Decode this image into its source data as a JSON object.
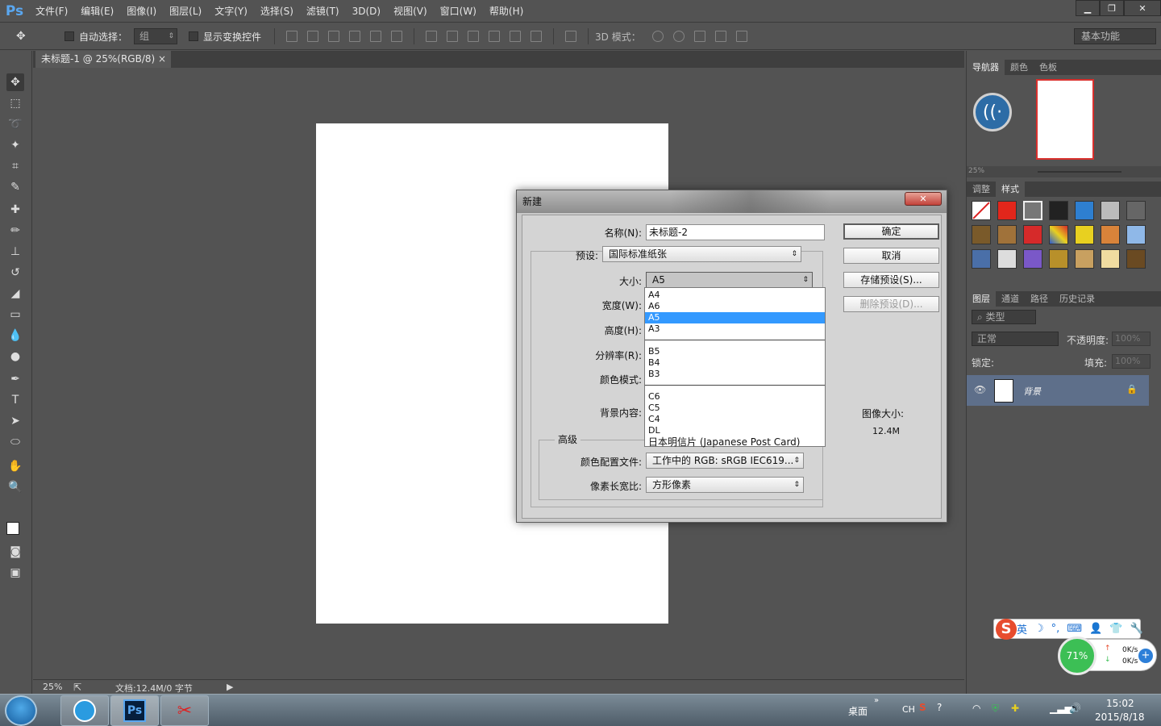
{
  "app": {
    "logo": "Ps"
  },
  "menu": [
    "文件(F)",
    "编辑(E)",
    "图像(I)",
    "图层(L)",
    "文字(Y)",
    "选择(S)",
    "滤镜(T)",
    "3D(D)",
    "视图(V)",
    "窗口(W)",
    "帮助(H)"
  ],
  "window_controls": {
    "minimize": "▁",
    "restore": "❐",
    "close": "✕"
  },
  "options": {
    "auto_select_label": "自动选择：",
    "auto_select_value": "组",
    "show_transform_label": "显示变换控件",
    "mode3d_label": "3D 模式：",
    "workspace": "基本功能"
  },
  "document": {
    "tab_title": "未标题-1 @ 25%(RGB/8)",
    "tab_close": "×",
    "zoom": "25%",
    "doc_info": "文档:12.4M/0 字节"
  },
  "panels": {
    "nav_tabs": [
      "导航器",
      "颜色",
      "色板"
    ],
    "nav_zoom": "25%",
    "adj_tabs": [
      "调整",
      "样式"
    ],
    "layer_tabs": [
      "图层",
      "通道",
      "路径",
      "历史记录"
    ],
    "layer_kind": "类型",
    "blend_mode": "正常",
    "opacity_label": "不透明度:",
    "opacity_value": "100%",
    "lock_label": "锁定:",
    "fill_label": "填充:",
    "fill_value": "100%",
    "layer_name": "背景",
    "style_colors": [
      "#ffffff",
      "#e2261b",
      "#777777",
      "#222222",
      "#2e7fd0",
      "#bbbbbb",
      "#666666",
      "#7a5a2a",
      "#a0723a",
      "#d62a2a",
      "#2b5bd0",
      "#e8d020",
      "#d8833a",
      "#8fb8e8",
      "#4a6fa8",
      "#dddddd",
      "#7a58c8",
      "#b8902a",
      "#c8a060",
      "#f0dca0",
      "#6a4a22"
    ]
  },
  "dialog": {
    "title": "新建",
    "close": "✕",
    "name_label": "名称(N):",
    "name_value": "未标题-2",
    "preset_label": "预设:",
    "preset_value": "国际标准纸张",
    "size_label": "大小:",
    "size_value": "A5",
    "width_label": "宽度(W):",
    "height_label": "高度(H):",
    "resolution_label": "分辨率(R):",
    "color_mode_label": "颜色模式:",
    "bg_label": "背景内容:",
    "advanced_label": "高级",
    "profile_label": "颜色配置文件:",
    "profile_value": "工作中的 RGB: sRGB IEC619...",
    "aspect_label": "像素长宽比:",
    "aspect_value": "方形像素",
    "ok": "确定",
    "cancel": "取消",
    "save_preset": "存储预设(S)...",
    "delete_preset": "删除预设(D)...",
    "image_size_label": "图像大小:",
    "image_size_value": "12.4M",
    "size_options_g1": [
      "A4",
      "A6",
      "A5",
      "A3"
    ],
    "size_options_g2": [
      "B5",
      "B4",
      "B3"
    ],
    "size_options_g3": [
      "C6",
      "C5",
      "C4",
      "DL",
      "日本明信片 (Japanese Post Card)"
    ]
  },
  "ime": {
    "logo": "S",
    "lang": "英",
    "moon": "☽",
    "punct": "°,",
    "kbd": "⌨",
    "user": "👤",
    "shirt": "👕",
    "wrench": "🔧"
  },
  "network": {
    "percent": "71%",
    "up": "0K/s",
    "down": "0K/s"
  },
  "taskbar": {
    "desktop_label": "桌面",
    "lang": "CH",
    "time": "15:02",
    "date": "2015/8/18"
  }
}
